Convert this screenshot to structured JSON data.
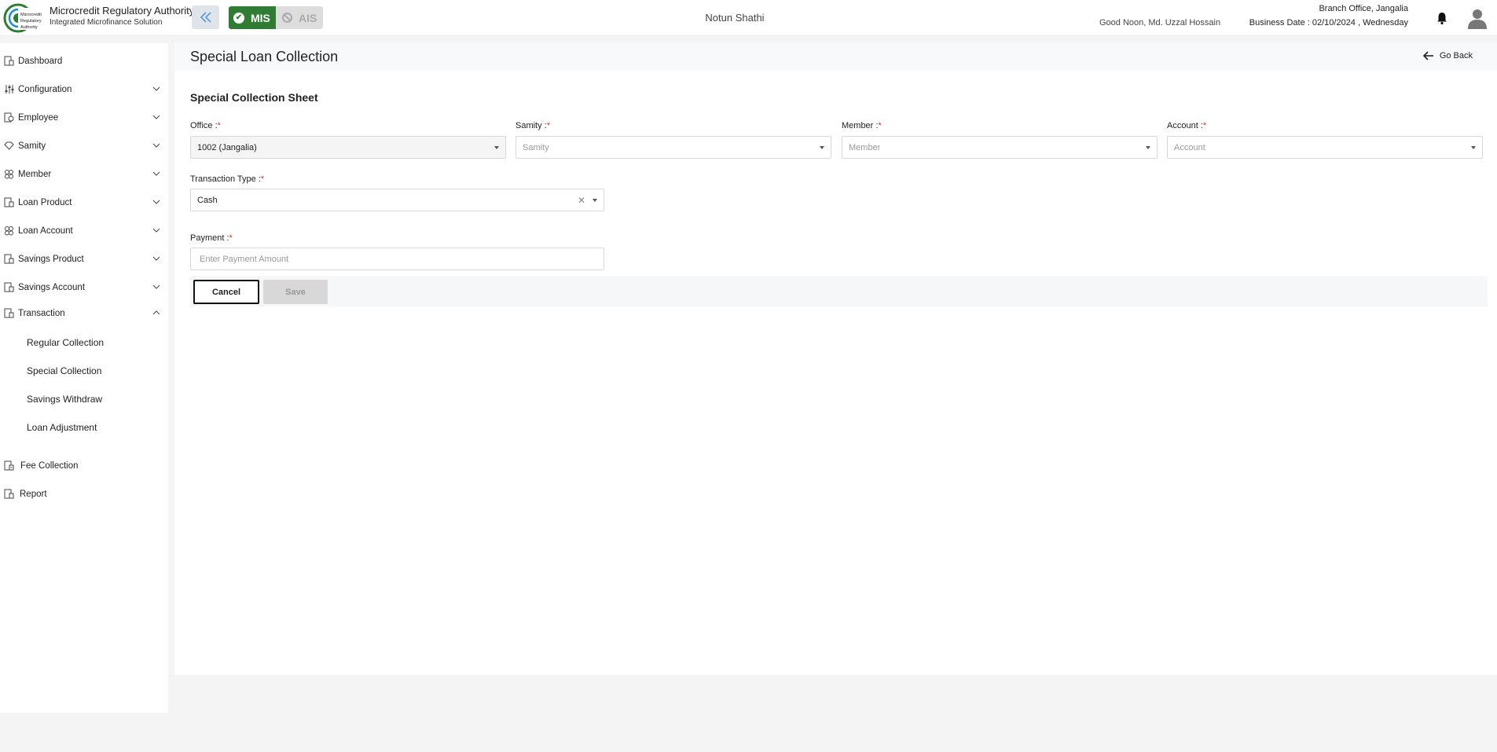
{
  "header": {
    "brand_title": "Microcredit Regulatory Authority",
    "brand_subtitle": "Integrated Microfinance Solution",
    "logo_text": "Microcredit Regulatory Authority",
    "mis_label": "MIS",
    "ais_label": "AIS",
    "org_name": "Notun Shathi",
    "branch": "Branch Office, Jangalia",
    "greeting": "Good Noon, Md. Uzzal Hossain",
    "business_date": "Business Date : 02/10/2024 , Wednesday",
    "accent_color": "#2e7d32"
  },
  "sidebar": {
    "items": [
      {
        "label": "Dashboard",
        "icon": "dashboard-icon"
      },
      {
        "label": "Configuration",
        "icon": "sliders-icon"
      },
      {
        "label": "Employee",
        "icon": "employee-icon"
      },
      {
        "label": "Samity",
        "icon": "samity-icon"
      },
      {
        "label": "Member",
        "icon": "member-icon"
      },
      {
        "label": "Loan Product",
        "icon": "loan-product-icon"
      },
      {
        "label": "Loan Account",
        "icon": "loan-account-icon"
      },
      {
        "label": "Savings Product",
        "icon": "savings-product-icon"
      },
      {
        "label": "Savings Account",
        "icon": "savings-account-icon"
      },
      {
        "label": "Transaction",
        "icon": "transaction-icon"
      },
      {
        "label": "Fee Collection",
        "icon": "fee-collection-icon"
      },
      {
        "label": "Report",
        "icon": "report-icon"
      }
    ],
    "transaction_sub": [
      {
        "label": "Regular Collection"
      },
      {
        "label": "Special Collection"
      },
      {
        "label": "Savings Withdraw"
      },
      {
        "label": "Loan Adjustment"
      }
    ]
  },
  "main": {
    "page_title": "Special Loan Collection",
    "go_back": "Go Back",
    "section_title": "Special Collection Sheet",
    "office": {
      "label": "Office :",
      "value": "1002 (Jangalia)"
    },
    "samity": {
      "label": "Samity :",
      "placeholder": "Samity"
    },
    "member": {
      "label": "Member :",
      "placeholder": "Member"
    },
    "account": {
      "label": "Account :",
      "placeholder": "Account"
    },
    "transaction_type": {
      "label": "Transaction Type :",
      "value": "Cash"
    },
    "payment": {
      "label": "Payment :",
      "placeholder": "Enter Payment Amount"
    },
    "required_mark": "*",
    "cancel_label": "Cancel",
    "save_label": "Save"
  }
}
